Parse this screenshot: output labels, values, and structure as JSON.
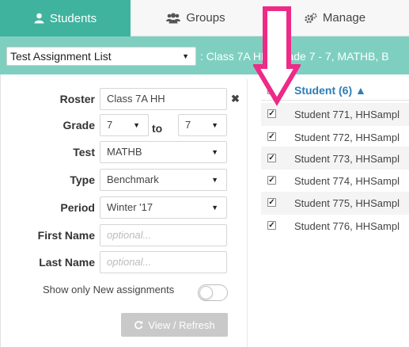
{
  "tabs": [
    {
      "label": "Students",
      "icon": "user-icon",
      "active": true
    },
    {
      "label": "Groups",
      "icon": "users-icon",
      "active": false
    },
    {
      "label": "Manage",
      "icon": "cogs-icon",
      "active": false
    }
  ],
  "list_selector": {
    "value": "Test Assignment List"
  },
  "filter_summary": ": Class 7A HH, Grade 7 - 7, MATHB, B",
  "form": {
    "roster_label": "Roster",
    "roster_value": "Class 7A HH",
    "grade_label": "Grade",
    "grade_from": "7",
    "to_label": "to",
    "grade_to": "7",
    "test_label": "Test",
    "test_value": "MATHB",
    "type_label": "Type",
    "type_value": "Benchmark",
    "period_label": "Period",
    "period_value": "Winter '17",
    "first_name_label": "First Name",
    "first_name_placeholder": "optional...",
    "last_name_label": "Last Name",
    "last_name_placeholder": "optional...",
    "new_only_label": "Show only New assignments",
    "new_only_on": false,
    "refresh_label": "View / Refresh"
  },
  "student_table": {
    "header": "Student (6) ▲",
    "rows": [
      "Student 771, HHSampl",
      "Student 772, HHSampl",
      "Student 773, HHSampl",
      "Student 774, HHSampl",
      "Student 775, HHSampl",
      "Student 776, HHSampl"
    ]
  },
  "colors": {
    "accent": "#3fb39e",
    "header_bar": "#7fcfc0",
    "link_blue": "#2f7db6",
    "annotation_arrow": "#ee2a87"
  }
}
